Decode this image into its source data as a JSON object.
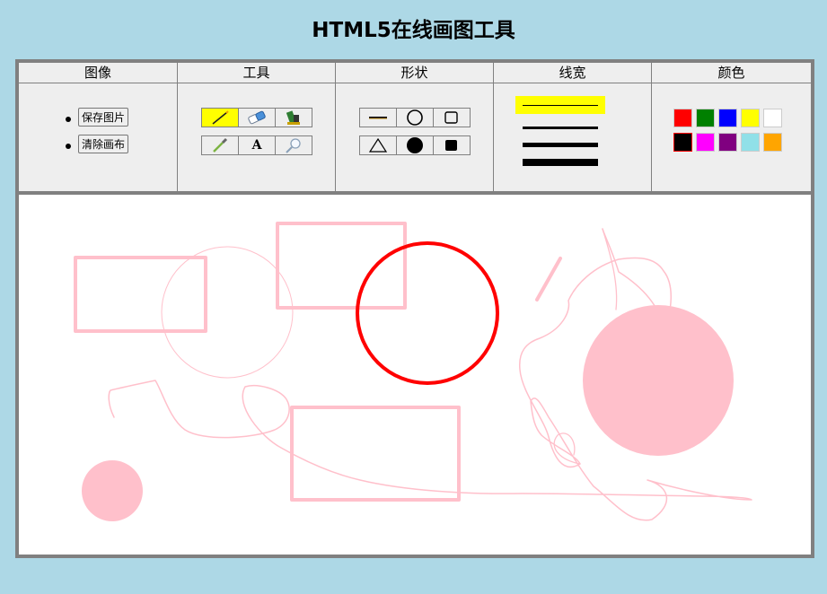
{
  "title": "HTML5在线画图工具",
  "columns": {
    "image": "图像",
    "tools": "工具",
    "shapes": "形状",
    "line_width": "线宽",
    "colors": "颜色"
  },
  "image_actions": {
    "save": "保存图片",
    "clear": "清除画布"
  },
  "tools": [
    {
      "name": "pencil",
      "active": true
    },
    {
      "name": "eraser",
      "active": false
    },
    {
      "name": "paint-bucket",
      "active": false
    },
    {
      "name": "eyedropper",
      "active": false
    },
    {
      "name": "text",
      "label": "A",
      "active": false
    },
    {
      "name": "magnifier",
      "active": false
    }
  ],
  "shapes": [
    "line",
    "circle",
    "rectangle",
    "triangle",
    "filled-circle",
    "filled-rectangle"
  ],
  "line_widths": [
    {
      "value": 1,
      "active": true
    },
    {
      "value": 3,
      "active": false
    },
    {
      "value": 5,
      "active": false
    },
    {
      "value": 8,
      "active": false
    }
  ],
  "palette": [
    "#ff0000",
    "#008000",
    "#0000ff",
    "#ffff00",
    "#ffffff",
    "#000000",
    "#ff00ff",
    "#800080",
    "#90e0e8",
    "#ffa500"
  ],
  "selected_color": "#000000",
  "canvas_stroke_color": "#ffc0cb",
  "accent_stroke_color": "#ff0000"
}
